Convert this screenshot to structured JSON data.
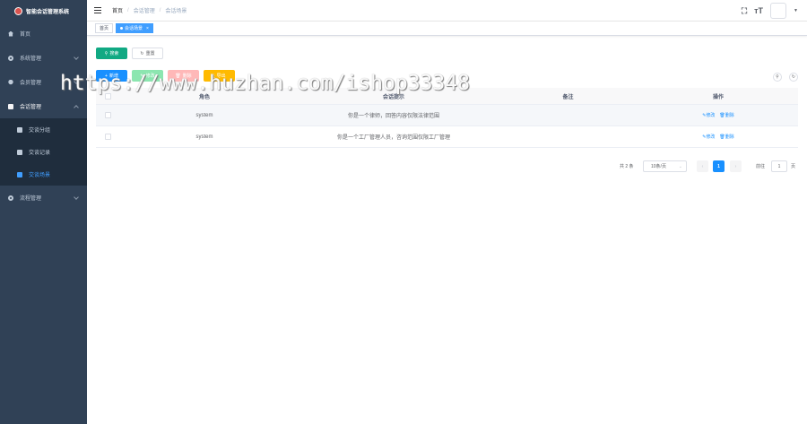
{
  "app": {
    "title": "智能会话管理系统"
  },
  "sidebar": {
    "items": [
      {
        "label": "首页",
        "icon": "home-icon"
      },
      {
        "label": "系统管理",
        "icon": "gear-icon"
      },
      {
        "label": "会员管理",
        "icon": "user-icon"
      },
      {
        "label": "会话管理",
        "icon": "document-icon",
        "children": [
          {
            "label": "交谈分组",
            "icon": "group-icon"
          },
          {
            "label": "交谈记录",
            "icon": "record-icon"
          },
          {
            "label": "交谈场景",
            "icon": "scene-icon"
          }
        ]
      },
      {
        "label": "流程管理",
        "icon": "flow-icon"
      }
    ]
  },
  "header": {
    "breadcrumb": [
      "首页",
      "会话管理",
      "会话场景"
    ],
    "fullscreen_icon": "⛶",
    "font_size_icon": "тT"
  },
  "tags": {
    "home": "首页",
    "active": "会话场景"
  },
  "search": {
    "search_label": "搜索",
    "reset_label": "重置"
  },
  "toolbar": {
    "add_label": "新增",
    "edit_label": "修改",
    "delete_label": "删除",
    "export_label": "导出"
  },
  "table": {
    "headers": [
      "角色",
      "会话提示",
      "备注",
      "操作"
    ],
    "rows": [
      {
        "role": "system",
        "prompt": "你是一个律师，回答内容仅限法律范围",
        "note": ""
      },
      {
        "role": "system",
        "prompt": "你是一个工厂管理人员，咨询范围仅限工厂管理",
        "note": ""
      }
    ],
    "action_edit": "修改",
    "action_delete": "删除"
  },
  "pagination": {
    "total": "共 2 条",
    "page_size": "10条/页",
    "current_page": "1",
    "goto_label": "前往",
    "goto_value": "1",
    "page_unit": "页"
  },
  "watermark": "https://www.huzhan.com/ishop33348"
}
